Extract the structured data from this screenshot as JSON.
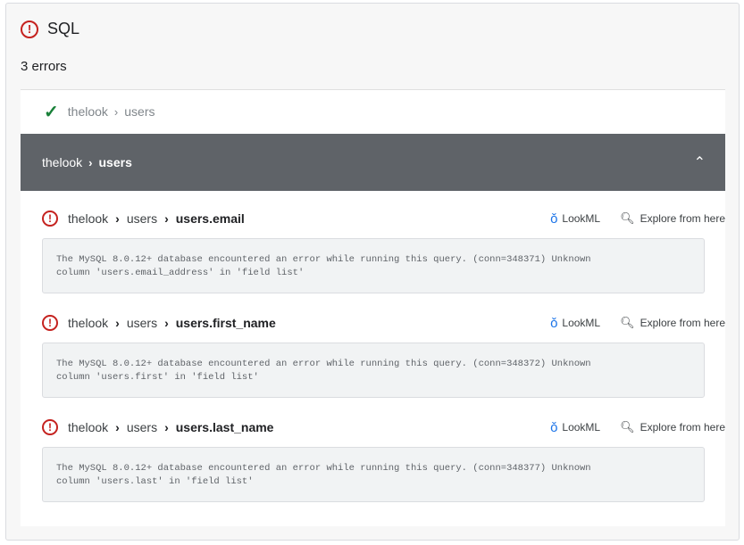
{
  "header": {
    "title": "SQL",
    "error_count": "3 errors"
  },
  "passed": {
    "model": "thelook",
    "explore": "users"
  },
  "group": {
    "model": "thelook",
    "explore": "users"
  },
  "errors": [
    {
      "model": "thelook",
      "explore": "users",
      "field": "users.email",
      "message": "The MySQL 8.0.12+ database encountered an error while running this query. (conn=348371) Unknown\ncolumn 'users.email_address' in 'field list'"
    },
    {
      "model": "thelook",
      "explore": "users",
      "field": "users.first_name",
      "message": "The MySQL 8.0.12+ database encountered an error while running this query. (conn=348372) Unknown\ncolumn 'users.first' in 'field list'"
    },
    {
      "model": "thelook",
      "explore": "users",
      "field": "users.last_name",
      "message": "The MySQL 8.0.12+ database encountered an error while running this query. (conn=348377) Unknown\ncolumn 'users.last' in 'field list'"
    }
  ],
  "actions": {
    "lookml": "LookML",
    "explore": "Explore from here"
  },
  "colors": {
    "error": "#c5221f",
    "success": "#188038",
    "group_bg": "#5f6368",
    "link_icon": "#1a73e8"
  },
  "icons": {
    "error": "error-circle-icon",
    "check": "check-icon",
    "caret": "chevron-up-icon",
    "lookml": "lookml-icon",
    "search": "search-icon"
  }
}
